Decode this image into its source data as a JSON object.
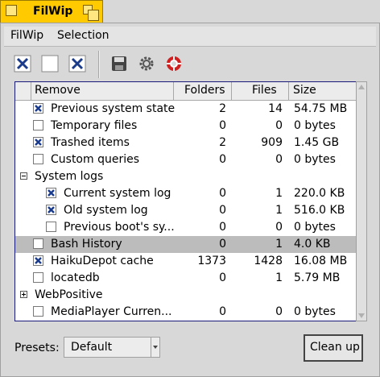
{
  "window": {
    "title": "FilWip"
  },
  "menubar": {
    "items": [
      "FilWip",
      "Selection"
    ]
  },
  "toolbar": {
    "icons": [
      "select-all-icon",
      "select-none-icon",
      "invert-selection-icon",
      "save-icon",
      "settings-gear-icon",
      "help-lifebuoy-icon"
    ]
  },
  "list": {
    "columns": [
      "Remove",
      "Folders",
      "Files",
      "Size"
    ],
    "rows": [
      {
        "name": "Previous system state",
        "folders": "2",
        "files": "14",
        "size": "54.75 MB",
        "checked": true
      },
      {
        "name": "Temporary files",
        "folders": "0",
        "files": "0",
        "size": "0 bytes",
        "checked": false
      },
      {
        "name": "Trashed items",
        "folders": "2",
        "files": "909",
        "size": "1.45 GB",
        "checked": true
      },
      {
        "name": "Custom queries",
        "folders": "0",
        "files": "0",
        "size": "0 bytes",
        "checked": false
      },
      {
        "name": "System logs",
        "group": true,
        "expanded": true
      },
      {
        "name": "Current system log",
        "folders": "0",
        "files": "1",
        "size": "220.0 KB",
        "checked": true,
        "indent": 1
      },
      {
        "name": "Old system log",
        "folders": "0",
        "files": "1",
        "size": "516.0 KB",
        "checked": true,
        "indent": 1
      },
      {
        "name": "Previous boot's sy...",
        "folders": "0",
        "files": "0",
        "size": "0 bytes",
        "checked": false,
        "indent": 1
      },
      {
        "name": "Bash History",
        "folders": "0",
        "files": "1",
        "size": "4.0 KB",
        "checked": false,
        "selected": true
      },
      {
        "name": "HaikuDepot cache",
        "folders": "1373",
        "files": "1428",
        "size": "16.08 MB",
        "checked": true
      },
      {
        "name": "locatedb",
        "folders": "0",
        "files": "1",
        "size": "5.79 MB",
        "checked": false
      },
      {
        "name": "WebPositive",
        "group": true,
        "expanded": false
      },
      {
        "name": "MediaPlayer Curren...",
        "folders": "0",
        "files": "0",
        "size": "0 bytes",
        "checked": false
      }
    ]
  },
  "presets": {
    "label": "Presets:",
    "value": "Default"
  },
  "cleanup_button": {
    "label": "Clean up"
  }
}
